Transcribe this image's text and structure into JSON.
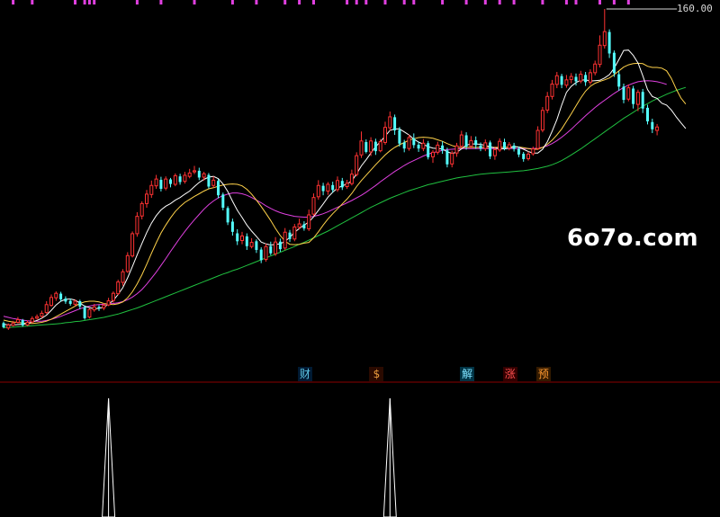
{
  "price_label": "160.00",
  "watermark": "6o7o.com",
  "badges": [
    {
      "label": "财",
      "color": "#5fc7e6",
      "bg": "#001a33"
    },
    {
      "label": "$",
      "color": "#e89a3c",
      "bg": "#2a0a00"
    },
    {
      "label": "解",
      "color": "#7fe3ff",
      "bg": "#003344"
    },
    {
      "label": "涨",
      "color": "#ff5050",
      "bg": "#330000"
    },
    {
      "label": "预",
      "color": "#ff9a30",
      "bg": "#331a00"
    }
  ],
  "colors": {
    "up": "#ff3232",
    "down": "#54ffff",
    "ma5": "#ffffff",
    "ma10": "#ffd24a",
    "ma20": "#e040e0",
    "ma60": "#20c040",
    "top_marks": "#e040e0",
    "separator": "#8b0000",
    "spike": "#ffffff"
  },
  "chart_data": {
    "type": "candlestick",
    "candles": [
      [
        104.7,
        103.6,
        105.1,
        103.3
      ],
      [
        103.4,
        104.2,
        104.6,
        102.9
      ],
      [
        104.1,
        104.7,
        105.3,
        103.8
      ],
      [
        104.9,
        105.6,
        106.3,
        104.6
      ],
      [
        105.5,
        104.1,
        105.8,
        103.7
      ],
      [
        104.2,
        104.9,
        105.4,
        103.9
      ],
      [
        105.0,
        105.9,
        106.5,
        104.7
      ],
      [
        106.0,
        106.4,
        107.0,
        105.6
      ],
      [
        106.5,
        107.3,
        108.0,
        106.0
      ],
      [
        107.5,
        109.6,
        110.5,
        107.1
      ],
      [
        109.4,
        111.5,
        112.3,
        109.0
      ],
      [
        111.4,
        112.6,
        113.1,
        110.6
      ],
      [
        112.5,
        111.0,
        113.0,
        110.4
      ],
      [
        111.2,
        110.4,
        111.8,
        109.8
      ],
      [
        110.6,
        109.8,
        111.2,
        109.3
      ],
      [
        109.7,
        110.5,
        111.0,
        109.2
      ],
      [
        110.5,
        109.1,
        110.9,
        108.4
      ],
      [
        108.9,
        106.0,
        109.4,
        105.6
      ],
      [
        106.3,
        108.3,
        108.7,
        105.9
      ],
      [
        108.2,
        109.0,
        109.8,
        107.7
      ],
      [
        109.0,
        108.6,
        109.5,
        107.9
      ],
      [
        108.7,
        109.4,
        110.0,
        108.1
      ],
      [
        109.5,
        110.6,
        111.4,
        109.2
      ],
      [
        110.7,
        112.6,
        113.1,
        110.1
      ],
      [
        112.5,
        115.6,
        116.2,
        112.1
      ],
      [
        115.5,
        118.3,
        119.0,
        114.6
      ],
      [
        118.4,
        122.6,
        123.5,
        118.0
      ],
      [
        122.5,
        128.4,
        129.0,
        122.1
      ],
      [
        128.4,
        133.0,
        134.1,
        127.6
      ],
      [
        133.1,
        136.4,
        137.0,
        132.2
      ],
      [
        136.4,
        138.9,
        140.0,
        135.3
      ],
      [
        138.8,
        141.2,
        142.5,
        137.9
      ],
      [
        141.1,
        142.9,
        144.0,
        140.3
      ],
      [
        142.7,
        140.3,
        143.5,
        139.6
      ],
      [
        140.5,
        142.9,
        143.6,
        139.9
      ],
      [
        142.8,
        141.6,
        143.2,
        140.7
      ],
      [
        141.5,
        143.8,
        144.4,
        141.0
      ],
      [
        143.6,
        142.1,
        144.3,
        141.4
      ],
      [
        142.3,
        143.9,
        144.8,
        141.7
      ],
      [
        143.6,
        144.5,
        145.6,
        143.1
      ],
      [
        144.8,
        145.1,
        146.4,
        144.2
      ],
      [
        145.1,
        143.3,
        145.9,
        142.6
      ],
      [
        143.4,
        144.3,
        144.8,
        142.5
      ],
      [
        144.0,
        140.9,
        144.5,
        140.4
      ],
      [
        141.2,
        142.6,
        143.6,
        140.6
      ],
      [
        142.4,
        138.6,
        142.9,
        137.8
      ],
      [
        138.8,
        135.3,
        139.3,
        134.6
      ],
      [
        135.2,
        131.4,
        135.7,
        130.7
      ],
      [
        131.6,
        128.9,
        132.4,
        127.9
      ],
      [
        128.5,
        126.4,
        129.6,
        125.4
      ],
      [
        126.6,
        127.8,
        128.9,
        125.6
      ],
      [
        127.7,
        125.1,
        128.5,
        124.1
      ],
      [
        125.0,
        126.1,
        127.2,
        124.5
      ],
      [
        126.4,
        124.1,
        126.9,
        123.3
      ],
      [
        124.2,
        121.4,
        124.8,
        120.6
      ],
      [
        121.6,
        125.0,
        125.8,
        121.0
      ],
      [
        125.1,
        123.2,
        126.3,
        122.7
      ],
      [
        123.1,
        126.2,
        127.5,
        122.5
      ],
      [
        126.3,
        124.3,
        127.1,
        123.6
      ],
      [
        124.6,
        128.8,
        129.9,
        124.0
      ],
      [
        128.7,
        127.0,
        129.4,
        126.2
      ],
      [
        127.0,
        130.2,
        131.0,
        126.4
      ],
      [
        130.1,
        131.0,
        132.4,
        129.5
      ],
      [
        130.9,
        129.8,
        131.7,
        129.2
      ],
      [
        129.7,
        133.4,
        134.8,
        129.1
      ],
      [
        133.6,
        138.0,
        139.1,
        133.1
      ],
      [
        138.2,
        141.2,
        142.6,
        137.4
      ],
      [
        141.1,
        139.7,
        141.9,
        138.6
      ],
      [
        139.7,
        141.5,
        142.1,
        138.7
      ],
      [
        141.3,
        140.0,
        142.2,
        139.3
      ],
      [
        140.1,
        142.5,
        143.6,
        139.5
      ],
      [
        142.4,
        140.7,
        143.2,
        140.0
      ],
      [
        140.9,
        141.8,
        142.7,
        140.3
      ],
      [
        141.7,
        144.2,
        145.4,
        141.2
      ],
      [
        144.1,
        149.1,
        150.0,
        143.6
      ],
      [
        149.3,
        153.0,
        155.5,
        148.5
      ],
      [
        152.7,
        150.1,
        153.4,
        149.7
      ],
      [
        150.1,
        153.0,
        154.0,
        149.0
      ],
      [
        152.8,
        150.3,
        153.6,
        149.3
      ],
      [
        150.4,
        152.8,
        153.5,
        150.0
      ],
      [
        152.6,
        156.6,
        158.1,
        152.0
      ],
      [
        156.5,
        159.4,
        160.8,
        155.7
      ],
      [
        159.3,
        155.8,
        160.0,
        154.6
      ],
      [
        155.9,
        152.3,
        156.7,
        151.5
      ],
      [
        152.6,
        151.0,
        153.3,
        150.0
      ],
      [
        151.0,
        153.9,
        154.7,
        150.4
      ],
      [
        153.7,
        151.9,
        155.0,
        151.1
      ],
      [
        152.0,
        151.0,
        152.8,
        150.1
      ],
      [
        151.0,
        152.4,
        153.5,
        150.3
      ],
      [
        152.4,
        148.7,
        153.0,
        148.1
      ],
      [
        148.8,
        150.0,
        150.6,
        147.2
      ],
      [
        150.0,
        151.9,
        152.8,
        149.4
      ],
      [
        151.8,
        150.5,
        152.9,
        149.6
      ],
      [
        150.5,
        146.8,
        151.2,
        146.0
      ],
      [
        146.9,
        149.7,
        150.4,
        146.0
      ],
      [
        149.8,
        151.7,
        152.5,
        148.8
      ],
      [
        151.6,
        154.6,
        155.7,
        151.0
      ],
      [
        154.5,
        151.5,
        155.3,
        150.7
      ],
      [
        151.6,
        153.1,
        154.3,
        151.0
      ],
      [
        153.2,
        151.9,
        154.2,
        150.9
      ],
      [
        151.8,
        151.0,
        152.6,
        150.3
      ],
      [
        151.0,
        152.5,
        153.4,
        150.3
      ],
      [
        152.6,
        148.9,
        153.1,
        148.2
      ],
      [
        149.1,
        150.7,
        151.5,
        148.0
      ],
      [
        150.6,
        152.9,
        153.7,
        150.1
      ],
      [
        152.7,
        151.0,
        153.6,
        150.5
      ],
      [
        151.1,
        152.0,
        152.7,
        150.5
      ],
      [
        151.8,
        150.9,
        152.5,
        150.2
      ],
      [
        150.9,
        149.4,
        151.5,
        148.7
      ],
      [
        149.6,
        148.2,
        150.1,
        147.5
      ],
      [
        148.3,
        149.5,
        150.2,
        147.8
      ],
      [
        149.6,
        150.9,
        151.5,
        149.1
      ],
      [
        151.0,
        155.8,
        156.9,
        150.6
      ],
      [
        155.9,
        161.1,
        162.0,
        155.3
      ],
      [
        161.2,
        164.8,
        166.0,
        160.4
      ],
      [
        164.8,
        168.1,
        169.2,
        164.0
      ],
      [
        168.0,
        170.3,
        171.3,
        167.0
      ],
      [
        170.2,
        167.9,
        170.8,
        167.0
      ],
      [
        167.8,
        169.2,
        170.5,
        167.1
      ],
      [
        169.3,
        170.1,
        171.0,
        168.3
      ],
      [
        170.0,
        168.8,
        170.9,
        167.7
      ],
      [
        168.9,
        170.7,
        171.6,
        168.3
      ],
      [
        170.5,
        168.6,
        171.3,
        167.6
      ],
      [
        168.6,
        171.1,
        172.0,
        167.9
      ],
      [
        171.1,
        173.4,
        174.3,
        170.4
      ],
      [
        173.3,
        178.4,
        181.0,
        172.5
      ],
      [
        178.3,
        182.0,
        188.0,
        177.5
      ],
      [
        181.9,
        176.2,
        182.6,
        175.0
      ],
      [
        176.4,
        171.0,
        177.0,
        170.0
      ],
      [
        170.7,
        167.4,
        171.5,
        166.3
      ],
      [
        167.4,
        163.9,
        168.2,
        163.0
      ],
      [
        164.1,
        167.1,
        168.0,
        163.5
      ],
      [
        166.9,
        162.8,
        167.6,
        161.6
      ],
      [
        162.7,
        165.9,
        166.6,
        160.9
      ],
      [
        166.0,
        161.6,
        166.8,
        160.4
      ],
      [
        161.8,
        158.2,
        162.6,
        157.4
      ],
      [
        158.0,
        156.1,
        158.9,
        155.1
      ],
      [
        155.8,
        156.7,
        157.5,
        154.5
      ]
    ],
    "ma5": [
      104.4,
      104.2,
      104.2,
      104.3,
      104.4,
      104.6,
      105.0,
      105.4,
      106.0,
      106.8,
      108.1,
      109.5,
      110.5,
      111.0,
      111.1,
      110.8,
      110.0,
      109.2,
      108.8,
      108.5,
      108.6,
      108.9,
      109.7,
      110.7,
      112.3,
      114.1,
      116.7,
      119.7,
      122.8,
      125.8,
      128.7,
      131.2,
      133.2,
      134.7,
      135.7,
      136.4,
      137.3,
      138.0,
      138.9,
      139.7,
      140.9,
      142.0,
      142.8,
      143.4,
      143.6,
      143.0,
      141.6,
      139.6,
      137.0,
      134.6,
      132.7,
      130.7,
      129.1,
      127.7,
      126.2,
      125.7,
      125.4,
      125.6,
      125.7,
      126.4,
      127.4,
      128.8,
      129.8,
      130.7,
      131.5,
      132.9,
      134.6,
      136.3,
      138.1,
      139.4,
      140.5,
      141.1,
      141.6,
      142.4,
      144.3,
      146.4,
      148.0,
      149.8,
      151.5,
      152.8,
      154.3,
      155.8,
      156.2,
      156.2,
      155.4,
      154.6,
      153.5,
      152.7,
      152.1,
      151.5,
      151.1,
      151.0,
      150.9,
      150.1,
      149.7,
      150.0,
      150.9,
      151.9,
      152.2,
      152.2,
      152.1,
      151.8,
      151.5,
      151.1,
      151.0,
      150.9,
      151.1,
      151.5,
      151.4,
      150.8,
      150.2,
      149.8,
      149.8,
      150.8,
      152.8,
      155.6,
      158.7,
      162.5,
      165.9,
      167.5,
      168.5,
      169.1,
      169.2,
      168.9,
      169.0,
      169.1,
      169.7,
      170.6,
      172.3,
      174.6,
      177.0,
      177.1,
      175.7,
      173.7,
      170.3,
      166.6,
      164.8,
      164.3,
      163.0,
      162.5,
      161.2,
      159.4,
      157.8,
      156.3
    ],
    "ma10": [
      105.5,
      105.2,
      105.0,
      104.9,
      104.7,
      104.6,
      104.6,
      104.7,
      104.9,
      105.2,
      105.7,
      106.4,
      107.1,
      107.8,
      108.5,
      109.2,
      109.9,
      110.3,
      110.5,
      110.5,
      110.3,
      109.9,
      109.7,
      109.6,
      109.8,
      110.3,
      111.4,
      113.0,
      115.1,
      117.5,
      120.3,
      123.2,
      126.0,
      128.6,
      130.7,
      132.6,
      134.3,
      135.6,
      136.7,
      137.5,
      138.3,
      139.0,
      139.7,
      140.3,
      140.6,
      141.0,
      141.3,
      141.5,
      141.6,
      141.5,
      141.1,
      140.2,
      138.9,
      137.3,
      135.6,
      133.8,
      131.9,
      129.8,
      127.9,
      126.4,
      125.6,
      125.5,
      125.6,
      125.9,
      126.1,
      127.3,
      128.9,
      130.7,
      132.3,
      133.7,
      135.0,
      136.3,
      137.6,
      139.1,
      140.9,
      142.5,
      143.9,
      145.3,
      146.7,
      148.0,
      149.3,
      150.4,
      151.3,
      152.0,
      152.6,
      153.2,
      153.6,
      153.9,
      154.0,
      153.9,
      153.7,
      153.3,
      152.9,
      152.3,
      151.8,
      151.4,
      151.2,
      151.3,
      151.3,
      151.3,
      151.3,
      151.3,
      151.3,
      151.3,
      151.3,
      151.3,
      151.4,
      151.5,
      151.4,
      151.2,
      151.0,
      150.8,
      150.8,
      151.3,
      152.1,
      153.2,
      154.6,
      156.2,
      158.2,
      160.2,
      162.3,
      164.4,
      166.2,
      167.5,
      168.3,
      168.8,
      169.2,
      169.7,
      170.6,
      171.6,
      172.6,
      173.2,
      173.5,
      173.6,
      173.5,
      172.8,
      172.5,
      172.5,
      172.3,
      171.6,
      169.6,
      166.8,
      164.4,
      162.8
    ],
    "ma20": [
      106.5,
      106.2,
      105.9,
      105.7,
      105.5,
      105.3,
      105.2,
      105.2,
      105.2,
      105.4,
      105.7,
      106.1,
      106.5,
      107.0,
      107.5,
      108.0,
      108.5,
      108.9,
      109.2,
      109.5,
      109.6,
      109.7,
      109.8,
      109.9,
      110.1,
      110.4,
      110.9,
      111.6,
      112.5,
      113.6,
      115.0,
      116.6,
      118.2,
      120.0,
      121.8,
      123.7,
      125.5,
      127.3,
      129.0,
      130.6,
      132.1,
      133.5,
      134.9,
      136.1,
      137.1,
      137.9,
      138.5,
      138.9,
      139.2,
      139.2,
      139.0,
      138.6,
      138.0,
      137.3,
      136.6,
      135.8,
      135.1,
      134.5,
      134.0,
      133.6,
      133.3,
      133.0,
      132.9,
      132.8,
      132.8,
      133.0,
      133.3,
      133.7,
      134.2,
      134.8,
      135.4,
      136.0,
      136.6,
      137.2,
      137.9,
      138.6,
      139.4,
      140.3,
      141.2,
      142.2,
      143.1,
      144.0,
      144.9,
      145.7,
      146.5,
      147.2,
      147.8,
      148.4,
      149.0,
      149.5,
      149.9,
      150.2,
      150.5,
      150.7,
      150.8,
      150.9,
      151.0,
      151.0,
      151.0,
      151.0,
      151.0,
      151.0,
      151.0,
      151.0,
      151.0,
      151.0,
      151.0,
      151.0,
      151.0,
      151.0,
      151.0,
      151.0,
      151.1,
      151.3,
      151.7,
      152.3,
      153.1,
      154.0,
      155.0,
      156.1,
      157.3,
      158.5,
      159.7,
      160.8,
      161.9,
      162.9,
      163.8,
      164.7,
      165.6,
      166.4,
      167.2,
      167.8,
      168.3,
      168.7,
      168.9,
      169.0,
      168.9,
      168.7,
      168.4,
      168.0
    ],
    "ma60": [
      103.5,
      103.6,
      103.6,
      103.7,
      103.8,
      103.9,
      104.0,
      104.1,
      104.2,
      104.3,
      104.4,
      104.5,
      104.6,
      104.8,
      104.9,
      105.1,
      105.2,
      105.4,
      105.6,
      105.8,
      106.0,
      106.2,
      106.5,
      106.8,
      107.1,
      107.5,
      107.9,
      108.3,
      108.7,
      109.2,
      109.7,
      110.2,
      110.7,
      111.2,
      111.7,
      112.2,
      112.7,
      113.2,
      113.7,
      114.2,
      114.7,
      115.2,
      115.7,
      116.2,
      116.7,
      117.2,
      117.7,
      118.1,
      118.6,
      119.0,
      119.5,
      120.0,
      120.5,
      121.0,
      121.5,
      122.0,
      122.5,
      123.0,
      123.5,
      124.0,
      124.5,
      125.0,
      125.6,
      126.1,
      126.7,
      127.3,
      127.9,
      128.5,
      129.1,
      129.8,
      130.5,
      131.2,
      131.9,
      132.6,
      133.3,
      134.0,
      134.7,
      135.4,
      136.0,
      136.6,
      137.2,
      137.8,
      138.3,
      138.8,
      139.3,
      139.8,
      140.2,
      140.6,
      141.0,
      141.4,
      141.7,
      142.0,
      142.3,
      142.6,
      142.9,
      143.2,
      143.4,
      143.6,
      143.8,
      144.0,
      144.2,
      144.3,
      144.4,
      144.5,
      144.6,
      144.7,
      144.8,
      144.9,
      145.0,
      145.1,
      145.3,
      145.5,
      145.7,
      146.0,
      146.3,
      146.7,
      147.2,
      147.8,
      148.5,
      149.3,
      150.1,
      150.9,
      151.8,
      152.7,
      153.6,
      154.5,
      155.4,
      156.3,
      157.2,
      158.1,
      159.0,
      159.8,
      160.6,
      161.4,
      162.2,
      162.9,
      163.6,
      164.2,
      164.8,
      165.4,
      165.9,
      166.4,
      166.8,
      167.2
    ],
    "y_range": [
      95,
      188
    ],
    "top_marks": [
      2,
      6,
      15,
      17,
      18,
      19,
      28,
      33,
      40,
      48,
      53,
      59,
      62,
      65,
      72,
      74,
      76,
      80,
      84,
      86,
      92,
      97,
      101,
      104,
      107,
      113,
      118,
      120,
      125,
      128,
      131
    ],
    "badge_at": [
      63,
      78,
      97,
      106,
      113
    ],
    "indicator_peaks": [
      22,
      81
    ]
  }
}
